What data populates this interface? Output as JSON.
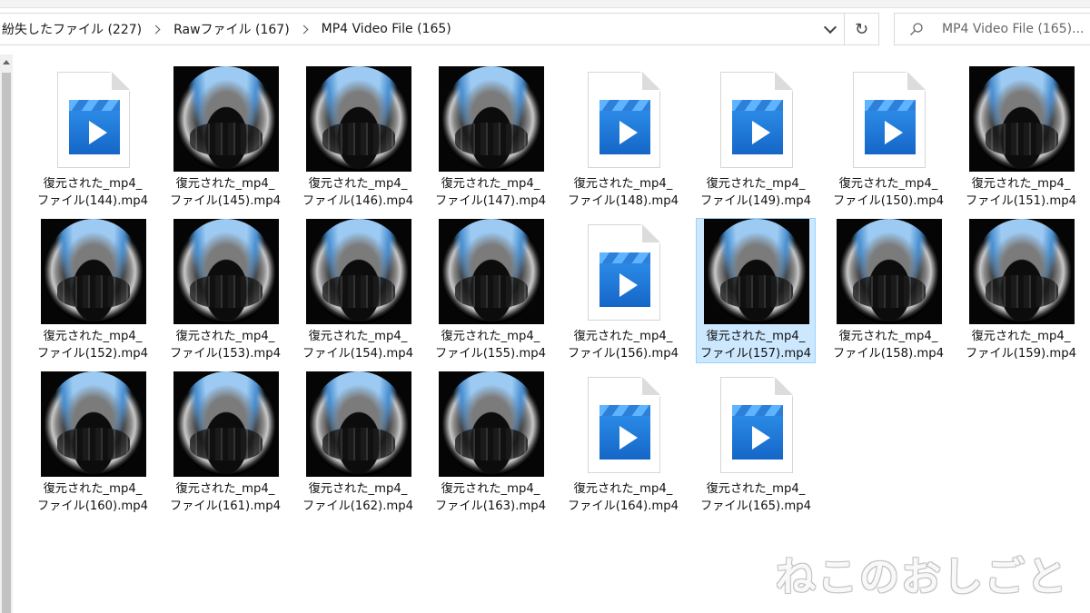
{
  "breadcrumbs": [
    "紛失したファイル (227)",
    "Rawファイル (167)",
    "MP4 Video File (165)"
  ],
  "search": {
    "placeholder": "MP4 Video File (165)..."
  },
  "icons": {
    "refresh": "refresh-icon",
    "search": "search-icon",
    "dropdown": "chevron-down-icon",
    "file": "video-file-icon"
  },
  "files": [
    {
      "line1": "復元された_mp4_",
      "line2": "ファイル(144).mp4",
      "kind": "doc"
    },
    {
      "line1": "復元された_mp4_",
      "line2": "ファイル(145).mp4",
      "kind": "photo"
    },
    {
      "line1": "復元された_mp4_",
      "line2": "ファイル(146).mp4",
      "kind": "photo"
    },
    {
      "line1": "復元された_mp4_",
      "line2": "ファイル(147).mp4",
      "kind": "photo"
    },
    {
      "line1": "復元された_mp4_",
      "line2": "ファイル(148).mp4",
      "kind": "doc"
    },
    {
      "line1": "復元された_mp4_",
      "line2": "ファイル(149).mp4",
      "kind": "doc"
    },
    {
      "line1": "復元された_mp4_",
      "line2": "ファイル(150).mp4",
      "kind": "doc"
    },
    {
      "line1": "復元された_mp4_",
      "line2": "ファイル(151).mp4",
      "kind": "photo"
    },
    {
      "line1": "復元された_mp4_",
      "line2": "ファイル(152).mp4",
      "kind": "photo"
    },
    {
      "line1": "復元された_mp4_",
      "line2": "ファイル(153).mp4",
      "kind": "photo"
    },
    {
      "line1": "復元された_mp4_",
      "line2": "ファイル(154).mp4",
      "kind": "photo"
    },
    {
      "line1": "復元された_mp4_",
      "line2": "ファイル(155).mp4",
      "kind": "photo"
    },
    {
      "line1": "復元された_mp4_",
      "line2": "ファイル(156).mp4",
      "kind": "doc"
    },
    {
      "line1": "復元された_mp4_",
      "line2": "ファイル(157).mp4",
      "kind": "photo",
      "selected": true
    },
    {
      "line1": "復元された_mp4_",
      "line2": "ファイル(158).mp4",
      "kind": "photo"
    },
    {
      "line1": "復元された_mp4_",
      "line2": "ファイル(159).mp4",
      "kind": "photo"
    },
    {
      "line1": "復元された_mp4_",
      "line2": "ファイル(160).mp4",
      "kind": "photo"
    },
    {
      "line1": "復元された_mp4_",
      "line2": "ファイル(161).mp4",
      "kind": "photo"
    },
    {
      "line1": "復元された_mp4_",
      "line2": "ファイル(162).mp4",
      "kind": "photo"
    },
    {
      "line1": "復元された_mp4_",
      "line2": "ファイル(163).mp4",
      "kind": "photo"
    },
    {
      "line1": "復元された_mp4_",
      "line2": "ファイル(164).mp4",
      "kind": "doc"
    },
    {
      "line1": "復元された_mp4_",
      "line2": "ファイル(165).mp4",
      "kind": "doc"
    }
  ],
  "watermark": "ねこのおしごと"
}
